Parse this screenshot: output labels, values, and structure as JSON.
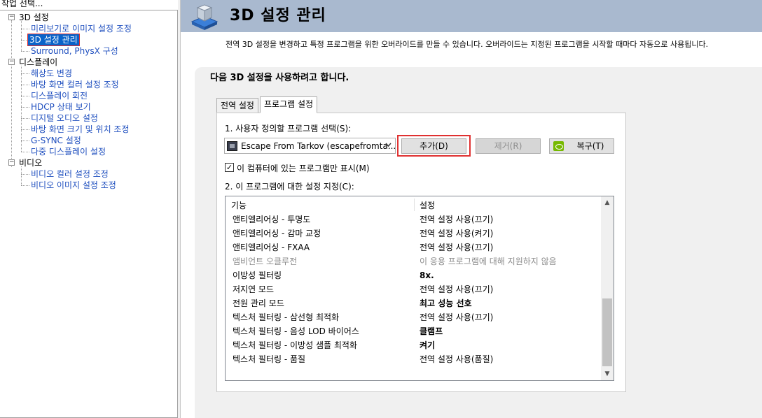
{
  "task_label": "작업 선택...",
  "tree": {
    "groups": [
      {
        "label": "3D 설정",
        "children": [
          "미리보기로 이미지 설정 조정",
          "3D 설정 관리",
          "Surround, PhysX 구성"
        ]
      },
      {
        "label": "디스플레이",
        "children": [
          "해상도 변경",
          "바탕 화면 컬러 설정 조정",
          "디스플레이 회전",
          "HDCP 상태 보기",
          "디지털 오디오 설정",
          "바탕 화면 크기 및 위치 조정",
          "G-SYNC 설정",
          "다중 디스플레이 설정"
        ]
      },
      {
        "label": "비디오",
        "children": [
          "비디오 컬러 설정 조정",
          "비디오 이미지 설정 조정"
        ]
      }
    ],
    "toggle_symbol": "−",
    "selected": "3D 설정 관리"
  },
  "header": {
    "title": "3D 설정 관리",
    "icon": "3d-settings-icon"
  },
  "description": "전역 3D 설정을 변경하고 특정 프로그램을 위한 오버라이드를 만들 수 있습니다. 오버라이드는 지정된 프로그램을 시작할 때마다 자동으로 사용됩니다.",
  "section_heading": "다음 3D 설정을 사용하려고 합니다.",
  "tabs": [
    {
      "label": "전역 설정",
      "active": false
    },
    {
      "label": "프로그램 설정",
      "active": true
    }
  ],
  "program_section": {
    "step1_label": "1. 사용자 정의할 프로그램 선택(S):",
    "selected_program": "Escape From Tarkov (escapefromta...",
    "add_label": "추가(D)",
    "remove_label": "제거(R)",
    "restore_label": "복구(T)",
    "checkbox_mark": "✓",
    "only_local_label": "이 컴퓨터에 있는 프로그램만 표시(M)",
    "only_local_checked": true,
    "step2_label": "2. 이 프로그램에 대한 설정 지정(C):"
  },
  "settings_table": {
    "headers": [
      "기능",
      "설정"
    ],
    "rows": [
      {
        "feature": "앤티엘리어싱 - 투명도",
        "value": "전역 설정 사용(끄기)",
        "style": "normal"
      },
      {
        "feature": "앤티엘리어싱 - 감마 교정",
        "value": "전역 설정 사용(켜기)",
        "style": "normal"
      },
      {
        "feature": "앤티엘리어싱 - FXAA",
        "value": "전역 설정 사용(끄기)",
        "style": "normal"
      },
      {
        "feature": "앰비언트 오클루전",
        "value": "이 응용 프로그램에 대해 지원하지 않음",
        "style": "disabled"
      },
      {
        "feature": "이방성 필터링",
        "value": "8x.",
        "style": "bold"
      },
      {
        "feature": "저지연 모드",
        "value": "전역 설정 사용(끄기)",
        "style": "normal"
      },
      {
        "feature": "전원 관리 모드",
        "value": "최고 성능 선호",
        "style": "bold"
      },
      {
        "feature": "텍스처 필터링 - 삼선형 최적화",
        "value": "전역 설정 사용(끄기)",
        "style": "normal"
      },
      {
        "feature": "텍스처 필터링 - 음성 LOD 바이어스",
        "value": "클램프",
        "style": "bold"
      },
      {
        "feature": "텍스처 필터링 - 이방성 샘플 최적화",
        "value": "켜기",
        "style": "bold"
      },
      {
        "feature": "텍스처 필터링 - 품질",
        "value": "전역 설정 사용(품질)",
        "style": "normal"
      }
    ],
    "scroll_up_glyph": "▲",
    "scroll_down_glyph": "▼"
  },
  "colors": {
    "header_bg": "#a9b9cf",
    "link_blue": "#1f4fbf",
    "selection_blue": "#0a63c9",
    "highlight_red": "#e03131",
    "nvidia_green": "#76b900"
  }
}
